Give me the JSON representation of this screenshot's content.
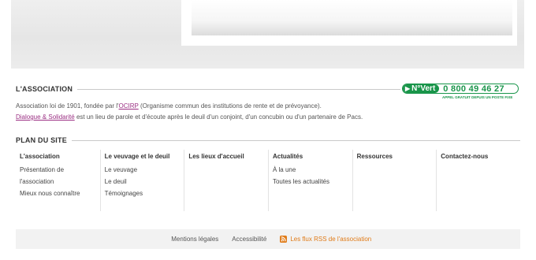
{
  "association": {
    "title": "L'ASSOCIATION",
    "line1_prefix": "Association loi de 1901, fondée par l'",
    "line1_link": "OCIRP",
    "line1_suffix": " (Organisme commun des institutions de rente et de prévoyance).",
    "line2_link": "Dialogue & Solidarité",
    "line2_suffix": " est un lieu de parole et d'écoute après le deuil d'un conjoint, d'un concubin ou d'un partenaire de Pacs."
  },
  "numero_vert": {
    "label": "N°Vert",
    "number": "0 800 49 46 27",
    "subtitle": "APPEL GRATUIT DEPUIS UN POSTE FIXE",
    "color": "#19954a"
  },
  "plan": {
    "title": "PLAN DU SITE",
    "columns": [
      {
        "title": "L'association",
        "links": [
          "Présentation de",
          "l'association",
          "Mieux nous connaître"
        ]
      },
      {
        "title": "Le veuvage et le deuil",
        "links": [
          "Le veuvage",
          "Le deuil",
          "Témoignages"
        ]
      },
      {
        "title": "Les lieux d'accueil",
        "links": []
      },
      {
        "title": "Actualités",
        "links": [
          "À la une",
          "Toutes les actualités"
        ]
      },
      {
        "title": "Ressources",
        "links": []
      },
      {
        "title": "Contactez-nous",
        "links": []
      }
    ]
  },
  "footer": {
    "links": [
      "Mentions légales",
      "Accessibilité"
    ],
    "rss_label": "Les flux RSS de l'association",
    "rss_color": "#e07b18",
    "rss_icon": "rss-icon"
  },
  "colors": {
    "link_purple": "#9b2f83"
  }
}
